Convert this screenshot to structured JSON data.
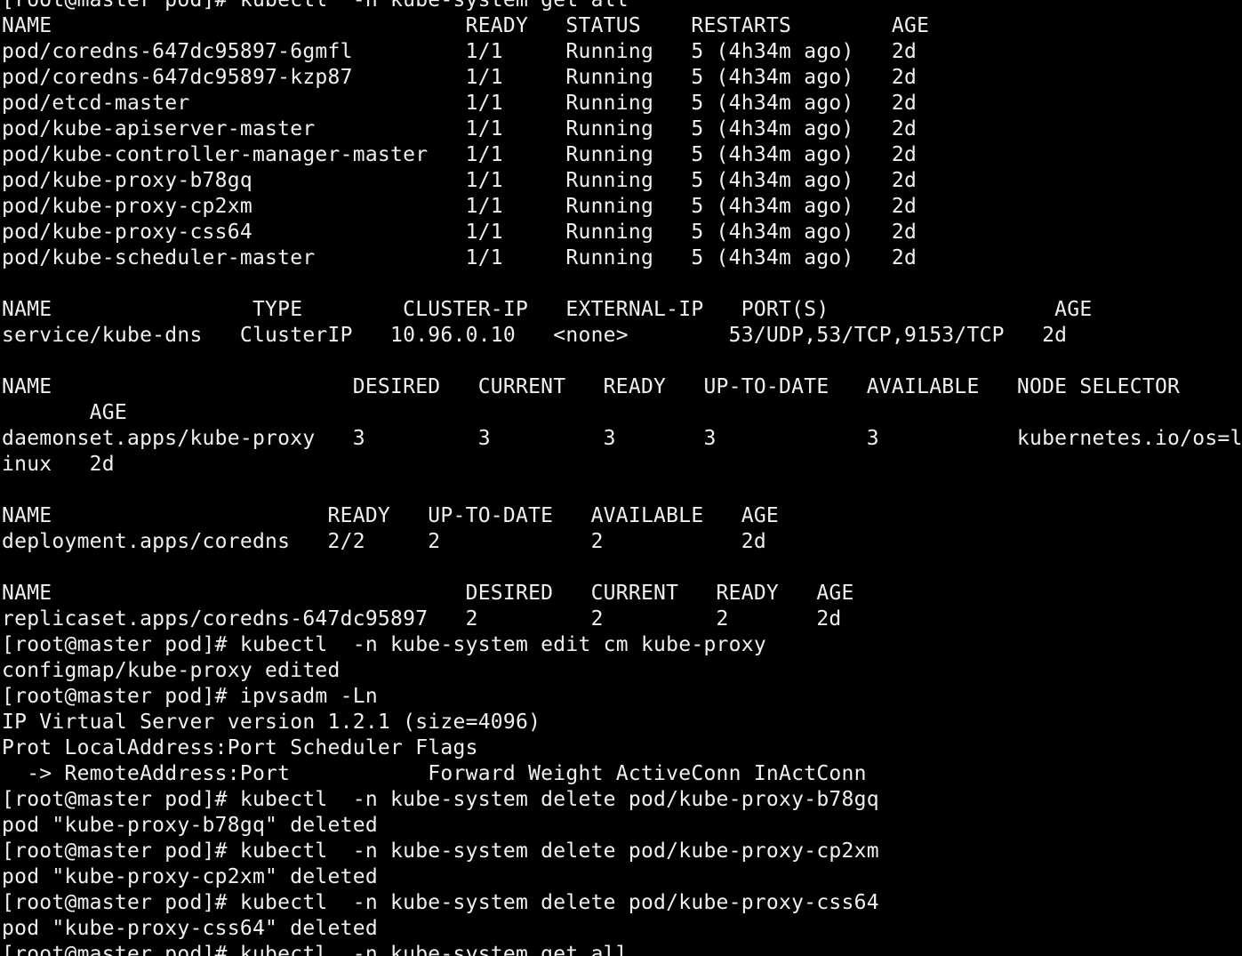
{
  "terminal": {
    "background": "#000000",
    "foreground": "#f0f0f0",
    "lines": [
      "[root@master pod]# kubectl  -n kube-system get all",
      "NAME                                 READY   STATUS    RESTARTS        AGE",
      "pod/coredns-647dc95897-6gmfl         1/1     Running   5 (4h34m ago)   2d",
      "pod/coredns-647dc95897-kzp87         1/1     Running   5 (4h34m ago)   2d",
      "pod/etcd-master                      1/1     Running   5 (4h34m ago)   2d",
      "pod/kube-apiserver-master            1/1     Running   5 (4h34m ago)   2d",
      "pod/kube-controller-manager-master   1/1     Running   5 (4h34m ago)   2d",
      "pod/kube-proxy-b78gq                 1/1     Running   5 (4h34m ago)   2d",
      "pod/kube-proxy-cp2xm                 1/1     Running   5 (4h34m ago)   2d",
      "pod/kube-proxy-css64                 1/1     Running   5 (4h34m ago)   2d",
      "pod/kube-scheduler-master            1/1     Running   5 (4h34m ago)   2d",
      "",
      "NAME                TYPE        CLUSTER-IP   EXTERNAL-IP   PORT(S)                  AGE",
      "service/kube-dns   ClusterIP   10.96.0.10   <none>        53/UDP,53/TCP,9153/TCP   2d",
      "",
      "NAME                        DESIRED   CURRENT   READY   UP-TO-DATE   AVAILABLE   NODE SELECTOR",
      "       AGE",
      "daemonset.apps/kube-proxy   3         3         3       3            3           kubernetes.io/os=l",
      "inux   2d",
      "",
      "NAME                      READY   UP-TO-DATE   AVAILABLE   AGE",
      "deployment.apps/coredns   2/2     2            2           2d",
      "",
      "NAME                                 DESIRED   CURRENT   READY   AGE",
      "replicaset.apps/coredns-647dc95897   2         2         2       2d",
      "[root@master pod]# kubectl  -n kube-system edit cm kube-proxy",
      "configmap/kube-proxy edited",
      "[root@master pod]# ipvsadm -Ln",
      "IP Virtual Server version 1.2.1 (size=4096)",
      "Prot LocalAddress:Port Scheduler Flags",
      "  -> RemoteAddress:Port           Forward Weight ActiveConn InActConn",
      "[root@master pod]# kubectl  -n kube-system delete pod/kube-proxy-b78gq",
      "pod \"kube-proxy-b78gq\" deleted",
      "[root@master pod]# kubectl  -n kube-system delete pod/kube-proxy-cp2xm",
      "pod \"kube-proxy-cp2xm\" deleted",
      "[root@master pod]# kubectl  -n kube-system delete pod/kube-proxy-css64",
      "pod \"kube-proxy-css64\" deleted",
      "[root@master pod]# kubectl  -n kube-system get all"
    ]
  }
}
